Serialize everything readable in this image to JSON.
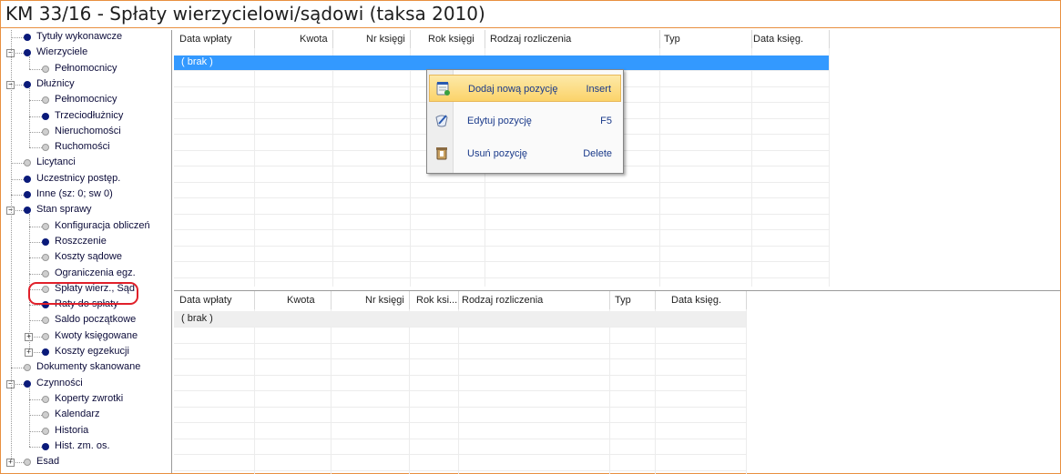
{
  "window": {
    "title": "KM 33/16 - Spłaty wierzycielowi/sądowi (taksa 2010)"
  },
  "tree": {
    "items": [
      {
        "label": "Tytuły wykonawcze",
        "dot": "blue",
        "level": 0
      },
      {
        "label": "Wierzyciele",
        "dot": "blue",
        "level": 0,
        "expander": "−"
      },
      {
        "label": "Pełnomocnicy",
        "dot": "gray",
        "level": 1
      },
      {
        "label": "Dłużnicy",
        "dot": "blue",
        "level": 0,
        "expander": "−"
      },
      {
        "label": "Pełnomocnicy",
        "dot": "gray",
        "level": 1
      },
      {
        "label": "Trzeciodłużnicy",
        "dot": "blue",
        "level": 1
      },
      {
        "label": "Nieruchomości",
        "dot": "gray",
        "level": 1
      },
      {
        "label": "Ruchomości",
        "dot": "gray",
        "level": 1
      },
      {
        "label": "Licytanci",
        "dot": "gray",
        "level": 0
      },
      {
        "label": "Uczestnicy postęp.",
        "dot": "blue",
        "level": 0
      },
      {
        "label": "Inne (sz: 0; sw 0)",
        "dot": "blue",
        "level": 0
      },
      {
        "label": "Stan sprawy",
        "dot": "blue",
        "level": 0,
        "expander": "−"
      },
      {
        "label": "Konfiguracja obliczeń",
        "dot": "gray",
        "level": 1
      },
      {
        "label": "Roszczenie",
        "dot": "blue",
        "level": 1
      },
      {
        "label": "Koszty sądowe",
        "dot": "gray",
        "level": 1
      },
      {
        "label": "Ograniczenia egz.",
        "dot": "gray",
        "level": 1
      },
      {
        "label": "Spłaty wierz., Sąd",
        "dot": "gray",
        "level": 1
      },
      {
        "label": "Raty do spłaty",
        "dot": "blue",
        "level": 1
      },
      {
        "label": "Saldo początkowe",
        "dot": "gray",
        "level": 1
      },
      {
        "label": "Kwoty księgowane",
        "dot": "gray",
        "level": 1,
        "expander": "+"
      },
      {
        "label": "Koszty egzekucji",
        "dot": "blue",
        "level": 1,
        "expander": "+"
      },
      {
        "label": "Dokumenty skanowane",
        "dot": "gray",
        "level": 0
      },
      {
        "label": "Czynności",
        "dot": "blue",
        "level": 0,
        "expander": "−"
      },
      {
        "label": "Koperty zwrotki",
        "dot": "gray",
        "level": 1
      },
      {
        "label": "Kalendarz",
        "dot": "gray",
        "level": 1
      },
      {
        "label": "Historia",
        "dot": "gray",
        "level": 1
      },
      {
        "label": "Hist. zm. os.",
        "dot": "blue",
        "level": 1
      },
      {
        "label": "Esad",
        "dot": "gray",
        "level": 0,
        "expander": "+"
      }
    ]
  },
  "grid_top": {
    "columns": [
      "Data wpłaty",
      "Kwota",
      "Nr księgi",
      "Rok księgi",
      "Rodzaj rozliczenia",
      "Typ",
      "Data księg."
    ],
    "rows": [
      [
        "( brak )"
      ]
    ]
  },
  "grid_bottom": {
    "columns": [
      "Data wpłaty",
      "Kwota",
      "Nr księgi",
      "Rok ksi...",
      "Rodzaj rozliczenia",
      "Typ",
      "Data księg."
    ],
    "rows": [
      [
        "( brak )"
      ]
    ]
  },
  "context_menu": {
    "items": [
      {
        "label": "Dodaj nową pozycję",
        "shortcut": "Insert",
        "icon": "notepad-add-icon"
      },
      {
        "label": "Edytuj pozycję",
        "shortcut": "F5",
        "icon": "edit-icon"
      },
      {
        "label": "Usuń pozycję",
        "shortcut": "Delete",
        "icon": "trash-icon"
      }
    ]
  },
  "colors": {
    "window_border": "#e89040",
    "selection": "#3399ff",
    "menu_hot": "#fbd36a",
    "tree_dot": "#0a1a7a",
    "highlight_ring": "#e0202a"
  }
}
